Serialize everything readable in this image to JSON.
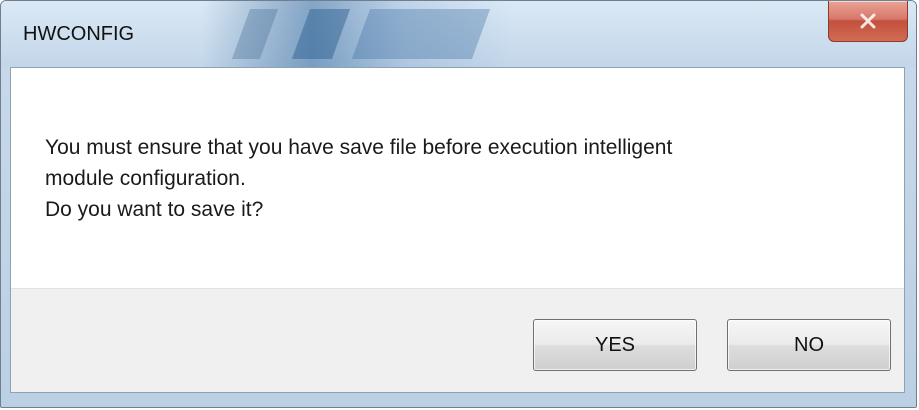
{
  "window": {
    "title": "HWCONFIG",
    "close_icon": "close-icon"
  },
  "message": {
    "lines": [
      "You must ensure that you have save file before execution intelligent",
      "module configuration.",
      "Do you want to save it?"
    ]
  },
  "buttons": {
    "yes_label": "YES",
    "no_label": "NO"
  },
  "colors": {
    "titlebar": "#cfe0f0",
    "close_button": "#c2503d",
    "footer": "#f0f0f0",
    "button_border": "#707070"
  }
}
